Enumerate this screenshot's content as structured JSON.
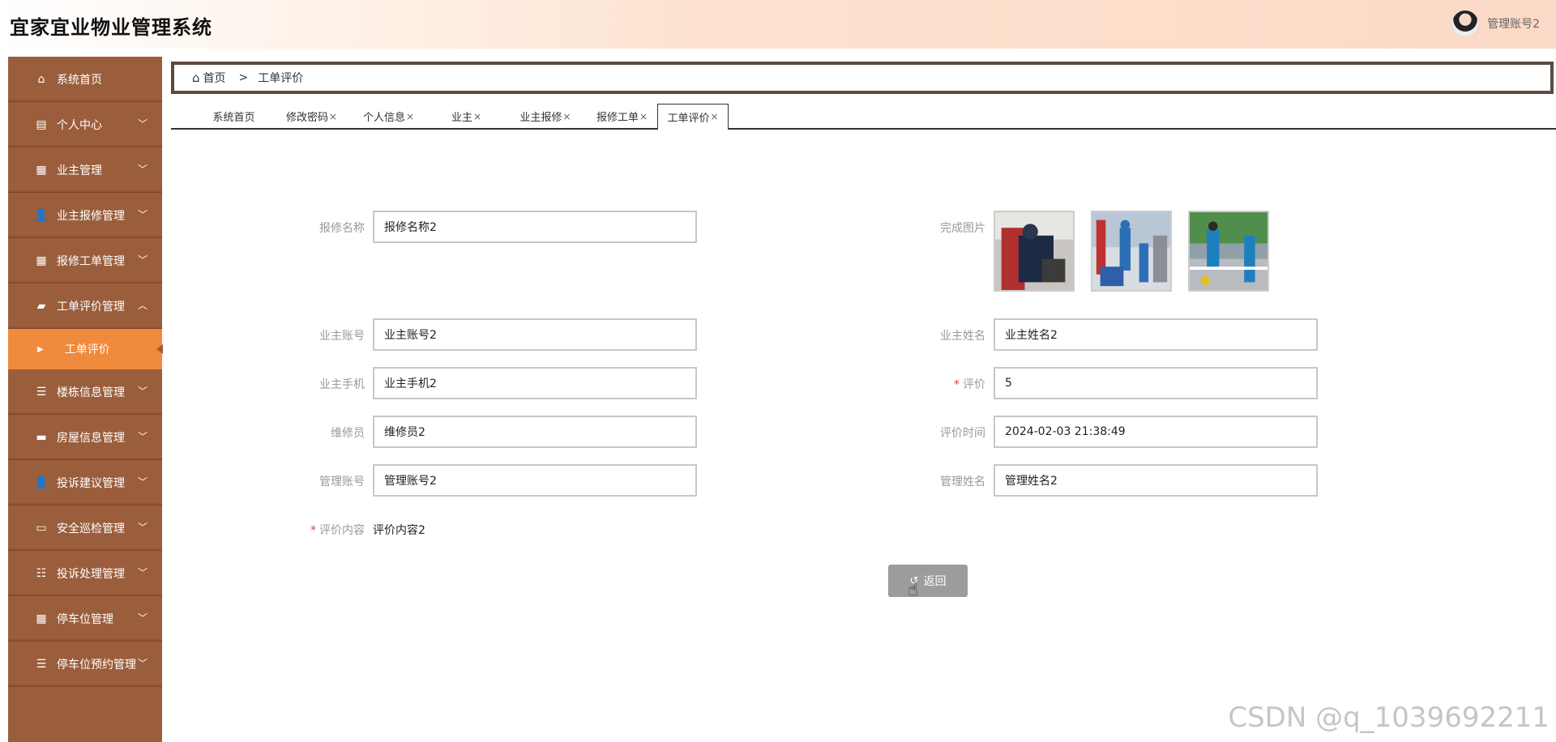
{
  "header": {
    "title": "宜家宜业物业管理系统",
    "username": "管理账号2"
  },
  "sidebar": {
    "items": [
      {
        "label": "系统首页",
        "icon": "home-icon",
        "glyph": "⌂",
        "chevron": ""
      },
      {
        "label": "个人中心",
        "icon": "card-icon",
        "glyph": "▤",
        "chevron": "﹀"
      },
      {
        "label": "业主管理",
        "icon": "grid-icon",
        "glyph": "▦",
        "chevron": "﹀"
      },
      {
        "label": "业主报修管理",
        "icon": "user-icon",
        "glyph": "👤",
        "chevron": "﹀"
      },
      {
        "label": "报修工单管理",
        "icon": "grid-icon",
        "glyph": "▦",
        "chevron": "﹀"
      },
      {
        "label": "工单评价管理",
        "icon": "briefcase-icon",
        "glyph": "▰",
        "chevron": "︿"
      },
      {
        "label": "楼栋信息管理",
        "icon": "list-icon",
        "glyph": "☰",
        "chevron": "﹀"
      },
      {
        "label": "房屋信息管理",
        "icon": "ticket-icon",
        "glyph": "▬",
        "chevron": "﹀"
      },
      {
        "label": "投诉建议管理",
        "icon": "user-icon",
        "glyph": "👤",
        "chevron": "﹀"
      },
      {
        "label": "安全巡检管理",
        "icon": "monitor-icon",
        "glyph": "▭",
        "chevron": "﹀"
      },
      {
        "label": "投诉处理管理",
        "icon": "sliders-icon",
        "glyph": "☷",
        "chevron": "﹀"
      },
      {
        "label": "停车位管理",
        "icon": "grid-icon",
        "glyph": "▦",
        "chevron": "﹀"
      },
      {
        "label": "停车位预约管理",
        "icon": "list-icon",
        "glyph": "☰",
        "chevron": "﹀"
      }
    ],
    "active_sub": "工单评价",
    "arrow_glyph": "▶"
  },
  "breadcrumb": {
    "home": "首页",
    "home_glyph": "⌂",
    "separator": ">",
    "current": "工单评价"
  },
  "tabs": [
    {
      "label": "系统首页",
      "closable": false
    },
    {
      "label": "修改密码",
      "closable": true
    },
    {
      "label": "个人信息",
      "closable": true
    },
    {
      "label": "业主",
      "closable": true
    },
    {
      "label": "业主报修",
      "closable": true
    },
    {
      "label": "报修工单",
      "closable": true
    },
    {
      "label": "工单评价",
      "closable": true,
      "active": true
    }
  ],
  "close_glyph": "×",
  "form": {
    "repair_name_label": "报修名称",
    "repair_name_value": "报修名称2",
    "photos_label": "完成图片",
    "owner_account_label": "业主账号",
    "owner_account_value": "业主账号2",
    "owner_name_label": "业主姓名",
    "owner_name_value": "业主姓名2",
    "owner_phone_label": "业主手机",
    "owner_phone_value": "业主手机2",
    "rating_label": "评价",
    "rating_value": "5",
    "repairer_label": "维修员",
    "repairer_value": "维修员2",
    "eval_time_label": "评价时间",
    "eval_time_value": "2024-02-03 21:38:49",
    "admin_account_label": "管理账号",
    "admin_account_value": "管理账号2",
    "admin_name_label": "管理姓名",
    "admin_name_value": "管理姓名2",
    "content_label": "评价内容",
    "content_value": "评价内容2",
    "required_mark": "*"
  },
  "back_button": {
    "label": "返回",
    "glyph": "↺"
  },
  "watermark": "CSDN @q_1039692211",
  "colors": {
    "sidebar": "#9b5e3c",
    "active_sub": "#f08a3c",
    "button": "#9c9c9c"
  }
}
